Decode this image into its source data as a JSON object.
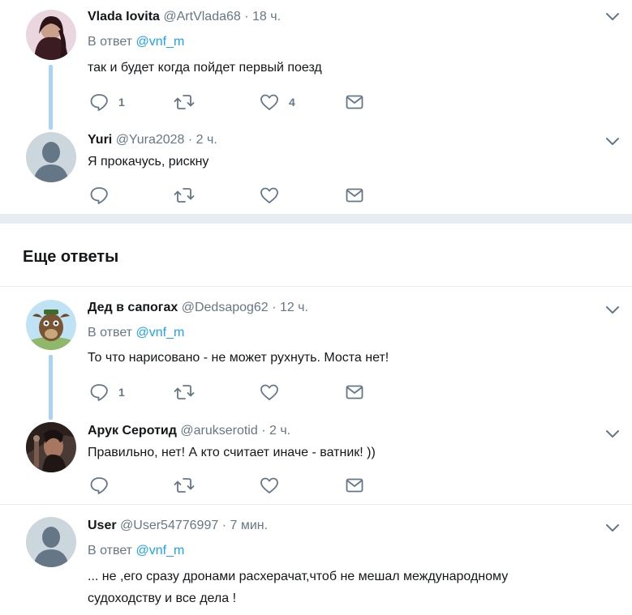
{
  "tweets": [
    {
      "name": "Vlada Iovita",
      "handle": "@ArtVlada68",
      "time": "18 ч.",
      "reply_prefix": "В ответ",
      "reply_mention": "@vnf_m",
      "text": "так и будет когда пойдет первый поезд",
      "reply_count": "1",
      "retweet_count": "",
      "like_count": "4",
      "avatar": "photo-woman"
    },
    {
      "name": "Yuri",
      "handle": "@Yura2028",
      "time": "2 ч.",
      "text": "Я прокачусь, рискну",
      "reply_count": "",
      "retweet_count": "",
      "like_count": "",
      "avatar": "default-avatar"
    },
    {
      "name": "Дед в сапогах",
      "handle": "@Dedsapog62",
      "time": "12 ч.",
      "reply_prefix": "В ответ",
      "reply_mention": "@vnf_m",
      "text": "То что нарисовано - не может рухнуть. Моста нет!",
      "reply_count": "1",
      "retweet_count": "",
      "like_count": "",
      "avatar": "cartoon-animal"
    },
    {
      "name": "Арук Серотид",
      "handle": "@arukserotid",
      "time": "2 ч.",
      "text": "Правильно, нет! А кто считает иначе - ватник! ))",
      "reply_count": "",
      "retweet_count": "",
      "like_count": "",
      "avatar": "photo-dark"
    },
    {
      "name": "User",
      "handle": "@User54776997",
      "time": "7 мин.",
      "reply_prefix": "В ответ",
      "reply_mention": "@vnf_m",
      "text": "... не ,его сразу дронами расхерачат,чтоб не мешал международному судоходству и все дела !",
      "reply_count": "",
      "retweet_count": "",
      "like_count": "",
      "avatar": "default-avatar"
    }
  ],
  "section": {
    "title": "Еще ответы"
  },
  "separator": "·",
  "colors": {
    "link": "#1da1f2",
    "muted": "#657786",
    "thread": "#a9d3f5",
    "divider": "#e6ecf0"
  }
}
